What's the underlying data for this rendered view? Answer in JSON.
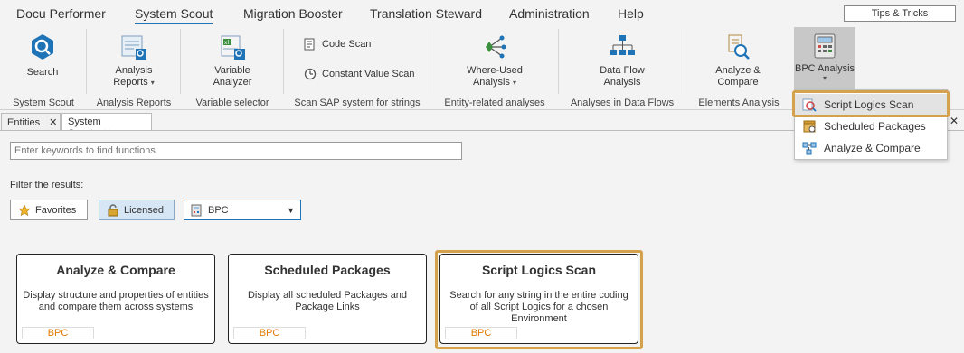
{
  "menu": {
    "items": [
      "Docu Performer",
      "System Scout",
      "Migration Booster",
      "Translation Steward",
      "Administration",
      "Help"
    ],
    "tips": "Tips & Tricks"
  },
  "ribbon": {
    "search": "Search",
    "group_system_scout": "System Scout",
    "analysis_reports_l1": "Analysis",
    "analysis_reports_l2": "Reports",
    "group_analysis_reports": "Analysis Reports",
    "variable_analyzer_l1": "Variable",
    "variable_analyzer_l2": "Analyzer",
    "group_variable_selector": "Variable selector",
    "code_scan": "Code Scan",
    "constant_value_scan": "Constant Value Scan",
    "group_scan_sap": "Scan SAP system for strings",
    "where_used_l1": "Where-Used",
    "where_used_l2": "Analysis",
    "group_entity_related": "Entity-related analyses",
    "data_flow_l1": "Data Flow",
    "data_flow_l2": "Analysis",
    "group_data_flows": "Analyses in Data Flows",
    "analyze_compare_l1": "Analyze &",
    "analyze_compare_l2": "Compare",
    "group_elements": "Elements Analysis",
    "bpc_analysis": "BPC Analysis"
  },
  "tabs": [
    {
      "label": "Entities"
    },
    {
      "label": "System Scout"
    }
  ],
  "content": {
    "search_placeholder": "Enter keywords to find functions",
    "filter_label": "Filter the results:",
    "favorites": "Favorites",
    "licensed": "Licensed",
    "dropdown_value": "BPC"
  },
  "cards": [
    {
      "title": "Analyze & Compare",
      "desc": "Display structure and properties of entities and compare them across systems",
      "tag": "BPC"
    },
    {
      "title": "Scheduled Packages",
      "desc": "Display all scheduled Packages and Package Links",
      "tag": "BPC"
    },
    {
      "title": "Script Logics Scan",
      "desc": "Search for any string in the entire coding of all Script Logics for a chosen Environment",
      "tag": "BPC"
    }
  ],
  "popmenu": {
    "items": [
      "Script Logics Scan",
      "Scheduled Packages",
      "Analyze & Compare"
    ]
  },
  "colors": {
    "accent": "#1f73b7",
    "highlight": "#d4a24c",
    "tag": "#e07a00"
  }
}
